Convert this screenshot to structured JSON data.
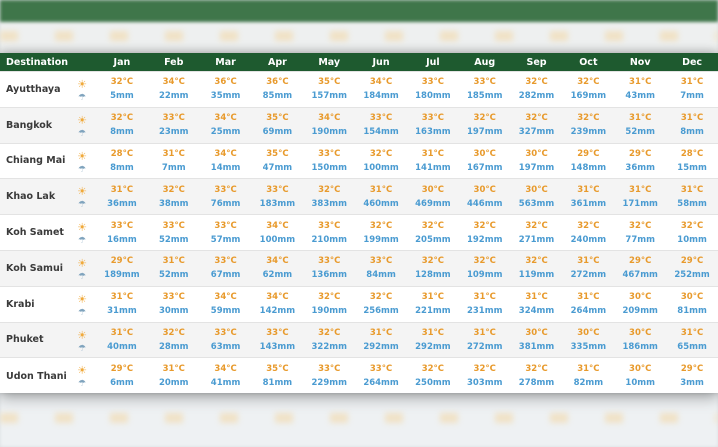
{
  "table": {
    "header_destination": "Destination",
    "months": [
      "Jan",
      "Feb",
      "Mar",
      "Apr",
      "May",
      "Jun",
      "Jul",
      "Aug",
      "Sep",
      "Oct",
      "Nov",
      "Dec"
    ],
    "rows": [
      {
        "name": "Ayutthaya",
        "temps": [
          "32°C",
          "34°C",
          "36°C",
          "36°C",
          "35°C",
          "34°C",
          "33°C",
          "33°C",
          "32°C",
          "32°C",
          "31°C",
          "31°C"
        ],
        "rain": [
          "5mm",
          "22mm",
          "35mm",
          "85mm",
          "157mm",
          "184mm",
          "180mm",
          "185mm",
          "282mm",
          "169mm",
          "43mm",
          "7mm"
        ]
      },
      {
        "name": "Bangkok",
        "temps": [
          "32°C",
          "33°C",
          "34°C",
          "35°C",
          "34°C",
          "33°C",
          "33°C",
          "32°C",
          "32°C",
          "32°C",
          "31°C",
          "31°C"
        ],
        "rain": [
          "8mm",
          "23mm",
          "25mm",
          "69mm",
          "190mm",
          "154mm",
          "163mm",
          "197mm",
          "327mm",
          "239mm",
          "52mm",
          "8mm"
        ]
      },
      {
        "name": "Chiang Mai",
        "temps": [
          "28°C",
          "31°C",
          "34°C",
          "35°C",
          "33°C",
          "32°C",
          "31°C",
          "30°C",
          "30°C",
          "29°C",
          "29°C",
          "28°C"
        ],
        "rain": [
          "8mm",
          "7mm",
          "14mm",
          "47mm",
          "150mm",
          "100mm",
          "141mm",
          "167mm",
          "197mm",
          "148mm",
          "36mm",
          "15mm"
        ]
      },
      {
        "name": "Khao Lak",
        "temps": [
          "31°C",
          "32°C",
          "33°C",
          "33°C",
          "32°C",
          "31°C",
          "30°C",
          "30°C",
          "30°C",
          "31°C",
          "31°C",
          "31°C"
        ],
        "rain": [
          "36mm",
          "38mm",
          "76mm",
          "183mm",
          "383mm",
          "460mm",
          "469mm",
          "446mm",
          "563mm",
          "361mm",
          "171mm",
          "58mm"
        ]
      },
      {
        "name": "Koh Samet",
        "temps": [
          "33°C",
          "33°C",
          "33°C",
          "34°C",
          "33°C",
          "32°C",
          "32°C",
          "32°C",
          "32°C",
          "32°C",
          "32°C",
          "32°C"
        ],
        "rain": [
          "16mm",
          "52mm",
          "57mm",
          "100mm",
          "210mm",
          "199mm",
          "205mm",
          "192mm",
          "271mm",
          "240mm",
          "77mm",
          "10mm"
        ]
      },
      {
        "name": "Koh Samui",
        "temps": [
          "29°C",
          "31°C",
          "33°C",
          "34°C",
          "33°C",
          "33°C",
          "32°C",
          "32°C",
          "32°C",
          "31°C",
          "29°C",
          "29°C"
        ],
        "rain": [
          "189mm",
          "52mm",
          "67mm",
          "62mm",
          "136mm",
          "84mm",
          "128mm",
          "109mm",
          "119mm",
          "272mm",
          "467mm",
          "252mm"
        ]
      },
      {
        "name": "Krabi",
        "temps": [
          "31°C",
          "33°C",
          "34°C",
          "34°C",
          "32°C",
          "32°C",
          "31°C",
          "31°C",
          "31°C",
          "31°C",
          "30°C",
          "30°C"
        ],
        "rain": [
          "31mm",
          "30mm",
          "59mm",
          "142mm",
          "190mm",
          "256mm",
          "221mm",
          "231mm",
          "324mm",
          "264mm",
          "209mm",
          "81mm"
        ]
      },
      {
        "name": "Phuket",
        "temps": [
          "31°C",
          "32°C",
          "33°C",
          "33°C",
          "32°C",
          "31°C",
          "31°C",
          "31°C",
          "30°C",
          "30°C",
          "30°C",
          "31°C"
        ],
        "rain": [
          "40mm",
          "28mm",
          "63mm",
          "143mm",
          "322mm",
          "292mm",
          "292mm",
          "272mm",
          "381mm",
          "335mm",
          "186mm",
          "65mm"
        ]
      },
      {
        "name": "Udon Thani",
        "temps": [
          "29°C",
          "31°C",
          "34°C",
          "35°C",
          "33°C",
          "33°C",
          "32°C",
          "32°C",
          "32°C",
          "31°C",
          "30°C",
          "29°C"
        ],
        "rain": [
          "6mm",
          "20mm",
          "41mm",
          "81mm",
          "229mm",
          "264mm",
          "250mm",
          "303mm",
          "278mm",
          "82mm",
          "10mm",
          "3mm"
        ]
      }
    ]
  },
  "icons": {
    "sun": "sun-icon",
    "rain": "rain-cloud-icon"
  },
  "colors": {
    "header": "#1e5a2f",
    "temp": "#e89a2c",
    "rain": "#4a9bd1"
  }
}
